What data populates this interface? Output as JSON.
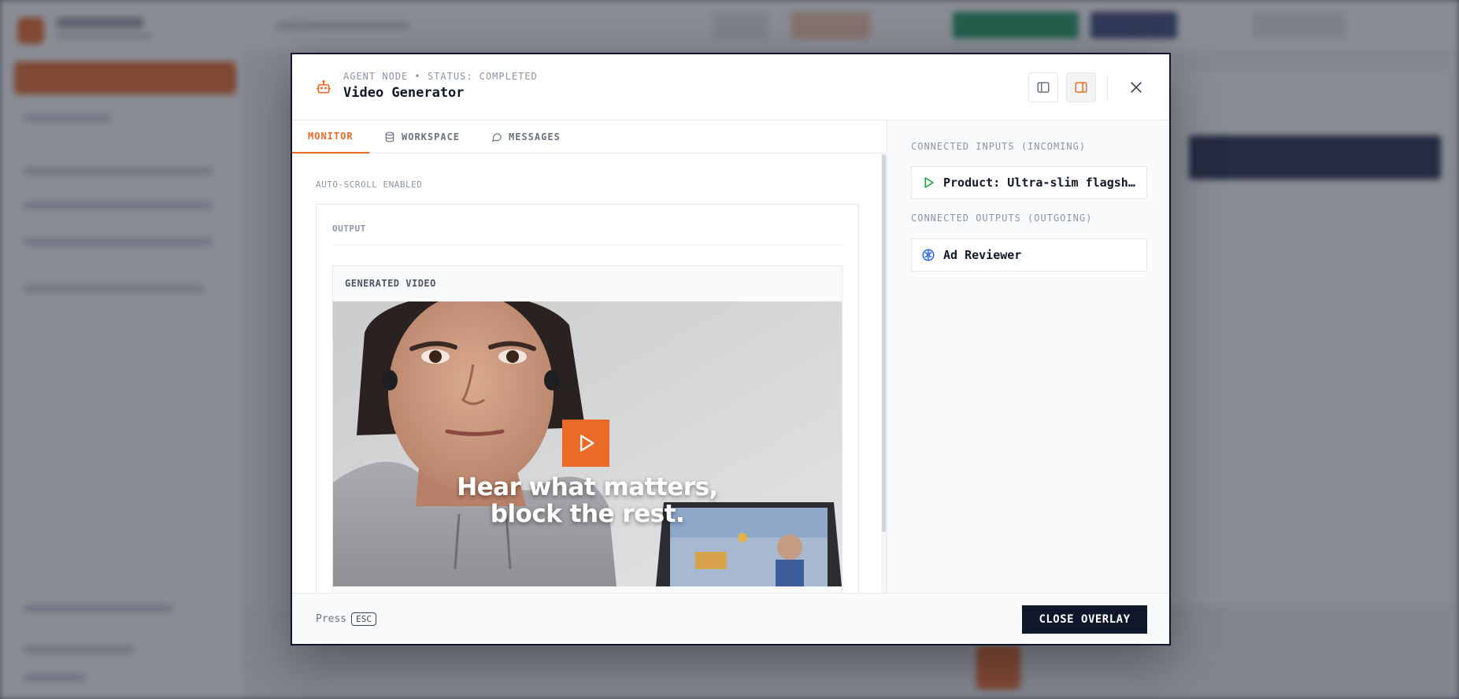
{
  "modal": {
    "kicker": "AGENT NODE • STATUS: COMPLETED",
    "title": "Video Generator",
    "tabs": [
      {
        "label": "MONITOR",
        "icon": "none"
      },
      {
        "label": "WORKSPACE",
        "icon": "database-icon"
      },
      {
        "label": "MESSAGES",
        "icon": "message-bubble-icon"
      }
    ],
    "autoscroll": "AUTO-SCROLL ENABLED",
    "output_label": "OUTPUT",
    "video_label": "GENERATED VIDEO",
    "video_caption_line1": "Hear what matters,",
    "video_caption_line2": "block the rest.",
    "right": {
      "inputs_label": "CONNECTED INPUTS (INCOMING)",
      "inputs": [
        {
          "label": "Product: Ultra-slim flagship true wireless earbuds",
          "icon": "play-icon"
        }
      ],
      "outputs_label": "CONNECTED OUTPUTS (OUTGOING)",
      "outputs": [
        {
          "label": "Ad Reviewer",
          "icon": "brain-icon"
        }
      ]
    },
    "footer": {
      "press": "Press",
      "key": "ESC",
      "close_label": "CLOSE OVERLAY"
    }
  },
  "colors": {
    "accent": "#ea6a2a",
    "dark": "#0f172a",
    "muted": "#8b95a5",
    "input_icon": "#16a34a",
    "output_icon": "#2563eb"
  }
}
